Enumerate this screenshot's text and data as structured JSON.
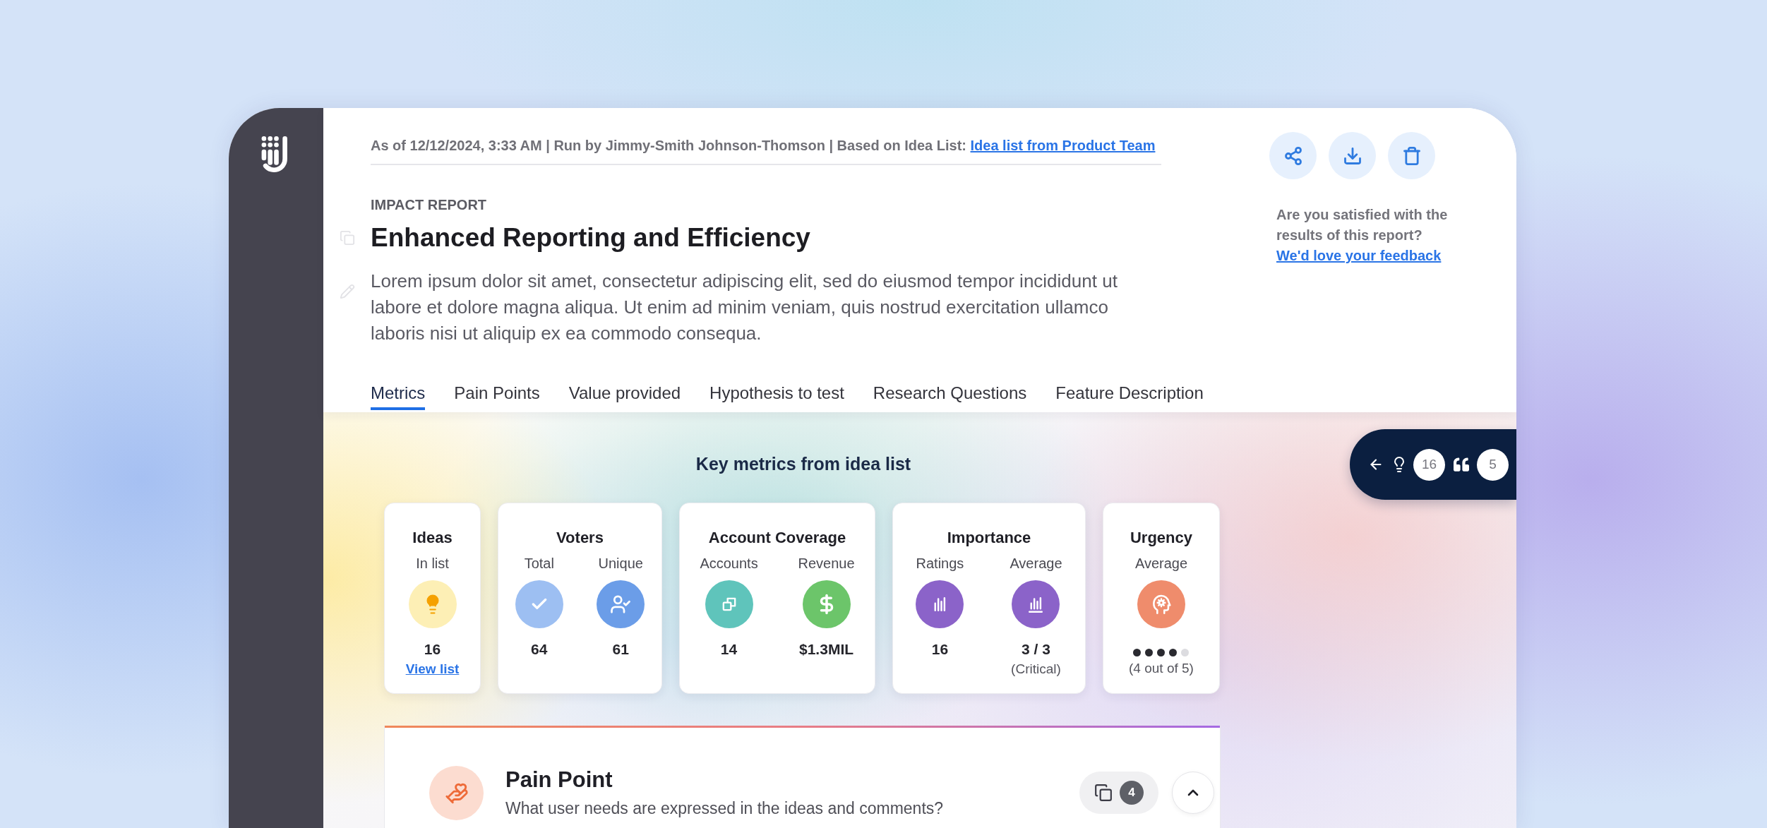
{
  "header": {
    "meta": {
      "text": "As of 12/12/2024, 3:33 AM | Run by Jimmy-Smith Johnson-Thomson | Based on Idea List:",
      "link": "Idea list from Product Team"
    },
    "eyebrow": "IMPACT REPORT",
    "title": "Enhanced Reporting and Efficiency",
    "description": "Lorem ipsum dolor sit amet, consectetur adipiscing elit, sed do eiusmod tempor incididunt ut labore et dolore magna aliqua. Ut enim ad minim veniam, quis nostrud exercitation ullamco laboris nisi ut aliquip ex ea commodo consequa."
  },
  "feedback": {
    "prompt": "Are you satisfied with the results of this report?",
    "link": "We'd love your feedback"
  },
  "tabs": [
    {
      "label": "Metrics",
      "selected": true
    },
    {
      "label": "Pain Points",
      "selected": false
    },
    {
      "label": "Value provided",
      "selected": false
    },
    {
      "label": "Hypothesis to test",
      "selected": false
    },
    {
      "label": "Research Questions",
      "selected": false
    },
    {
      "label": "Feature Description",
      "selected": false
    }
  ],
  "metrics": {
    "title": "Key metrics from idea list",
    "cards": [
      {
        "title": "Ideas",
        "columns": [
          {
            "kind": "value",
            "label": "In list",
            "value": "16",
            "link": "View list"
          }
        ]
      },
      {
        "title": "Voters",
        "columns": [
          {
            "kind": "value",
            "label": "Total",
            "value": "64"
          },
          {
            "kind": "value",
            "label": "Unique",
            "value": "61"
          }
        ]
      },
      {
        "title": "Account Coverage",
        "columns": [
          {
            "kind": "value",
            "label": "Accounts",
            "value": "14"
          },
          {
            "kind": "value",
            "label": "Revenue",
            "value": "$1.3MIL"
          }
        ]
      },
      {
        "title": "Importance",
        "columns": [
          {
            "kind": "value",
            "label": "Ratings",
            "value": "16"
          },
          {
            "kind": "value",
            "label": "Average",
            "value": "3 / 3",
            "note": "(Critical)"
          }
        ]
      },
      {
        "title": "Urgency",
        "columns": [
          {
            "kind": "rating",
            "label": "Average",
            "stars": 4,
            "note": "(4 out of 5)"
          }
        ]
      }
    ]
  },
  "side_panel": {
    "counts": [
      "16",
      "5"
    ]
  },
  "section": {
    "title": "Pain Point",
    "subtitle": "What user needs are expressed in the ideas and comments?",
    "count": "4",
    "expanded": true
  }
}
